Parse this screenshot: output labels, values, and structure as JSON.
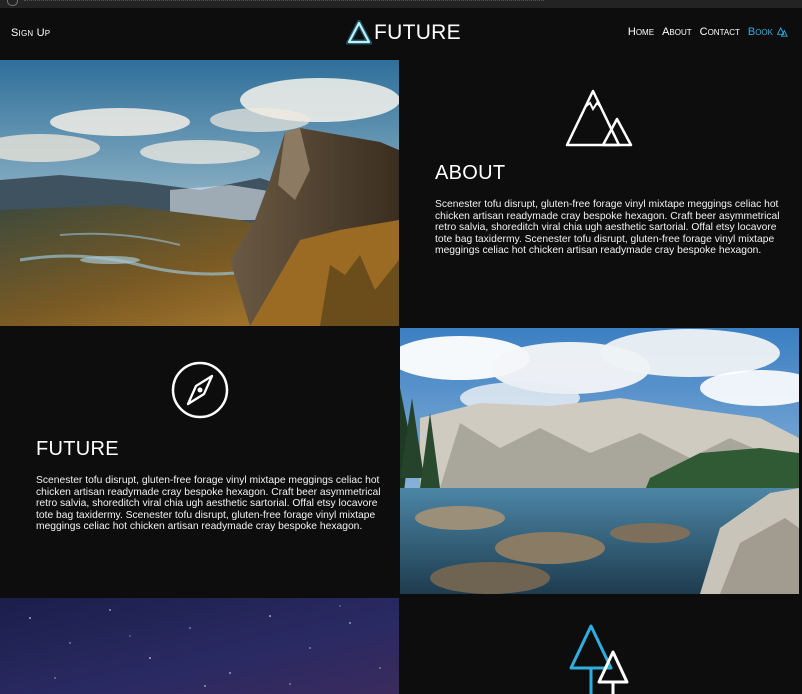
{
  "header": {
    "signup_label": "Sign Up",
    "brand": "FUTURE",
    "nav": [
      "Home",
      "About",
      "Contact",
      "Book"
    ]
  },
  "sections": {
    "about": {
      "icon": "mountain-icon",
      "title": "ABOUT",
      "text": "Scenester tofu disrupt, gluten-free forage vinyl mixtape meggings celiac hot chicken artisan readymade cray bespoke hexagon. Craft beer asymmetrical retro salvia, shoreditch viral chia ugh aesthetic sartorial. Offal etsy locavore tote bag taxidermy. Scenester tofu disrupt, gluten-free forage vinyl mixtape meggings celiac hot chicken artisan readymade cray bespoke hexagon."
    },
    "future": {
      "icon": "compass-icon",
      "title": "FUTURE",
      "text": "Scenester tofu disrupt, gluten-free forage vinyl mixtape meggings celiac hot chicken artisan readymade cray bespoke hexagon. Craft beer asymmetrical retro salvia, shoreditch viral chia ugh aesthetic sartorial. Offal etsy locavore tote bag taxidermy. Scenester tofu disrupt, gluten-free forage vinyl mixtape meggings celiac hot chicken artisan readymade cray bespoke hexagon."
    },
    "trees": {
      "icon": "trees-icon"
    }
  },
  "colors": {
    "background": "#0d0d0d",
    "accent": "#2eaee0",
    "text": "#ffffff"
  }
}
